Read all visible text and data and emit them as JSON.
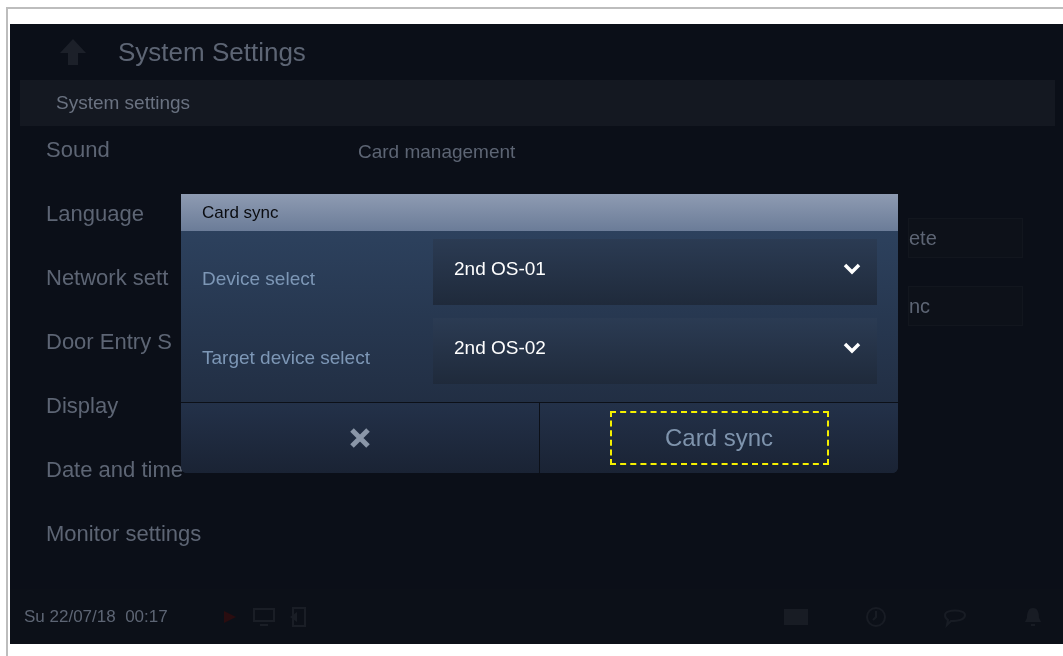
{
  "header": {
    "title": "System Settings"
  },
  "section": {
    "title": "System settings"
  },
  "sidebar": {
    "items": [
      {
        "label": "Sound"
      },
      {
        "label": "Language"
      },
      {
        "label": "Network sett"
      },
      {
        "label": "Door Entry S"
      },
      {
        "label": "Display"
      },
      {
        "label": "Date and time"
      },
      {
        "label": "Monitor settings"
      }
    ]
  },
  "panel": {
    "title": "Card management",
    "buttons": [
      "ete",
      "nc"
    ]
  },
  "status_bar": {
    "datetime": "Su 22/07/18  00:17"
  },
  "dialog": {
    "title": "Card sync",
    "fields": [
      {
        "label": "Device select",
        "value": "2nd OS-01"
      },
      {
        "label": "Target device select",
        "value": "2nd OS-02"
      }
    ],
    "confirm": {
      "label": "Card sync",
      "focused": true
    }
  }
}
